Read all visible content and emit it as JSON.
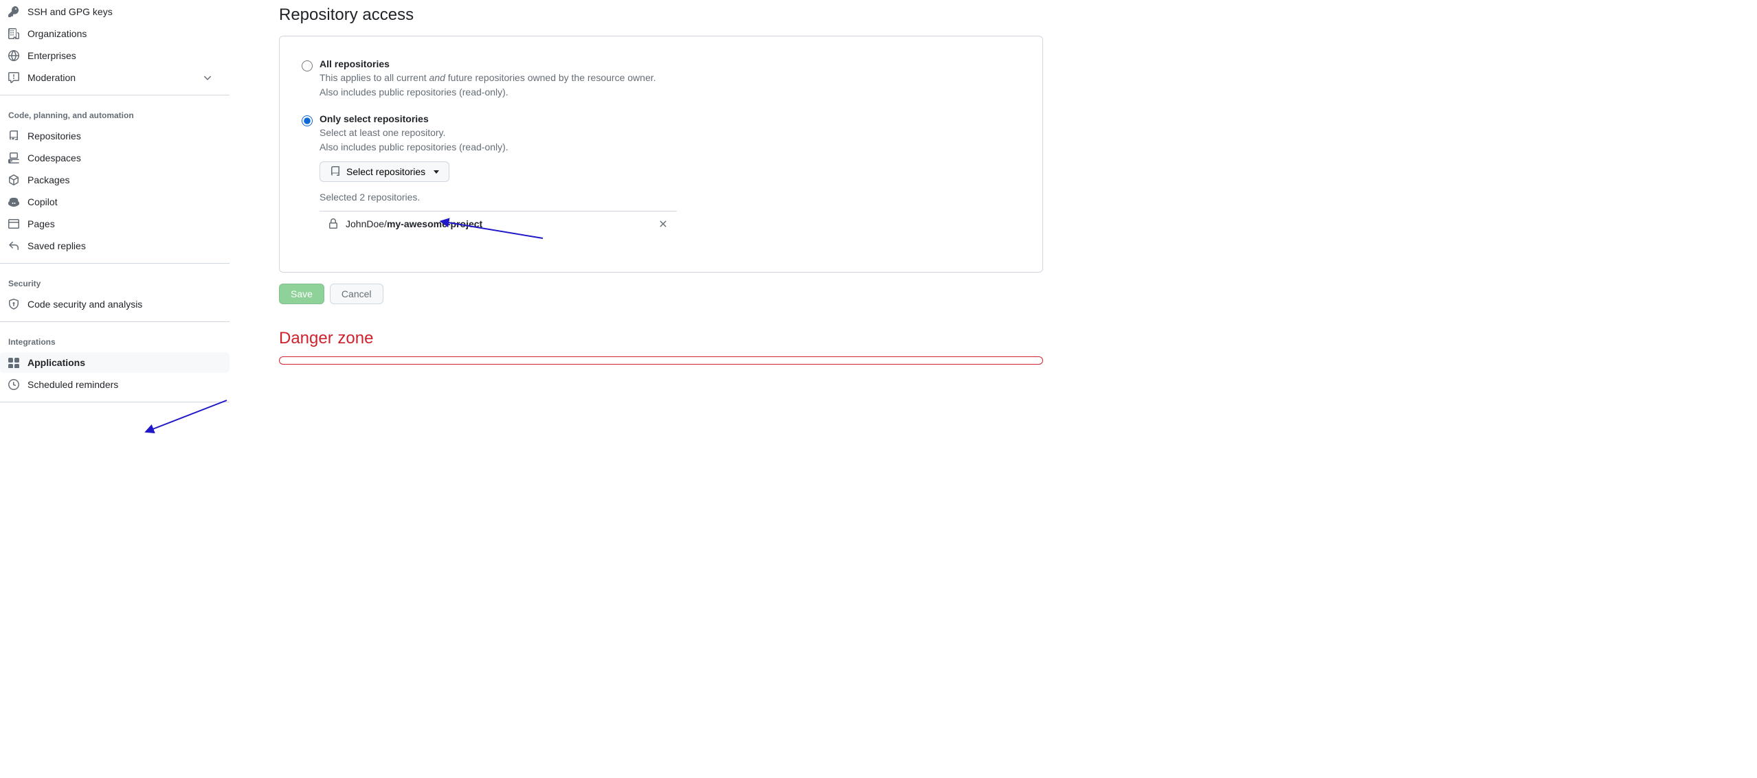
{
  "sidebar": {
    "items_top": [
      {
        "label": "SSH and GPG keys"
      },
      {
        "label": "Organizations"
      },
      {
        "label": "Enterprises"
      },
      {
        "label": "Moderation"
      }
    ],
    "section_code": "Code, planning, and automation",
    "items_code": [
      {
        "label": "Repositories"
      },
      {
        "label": "Codespaces"
      },
      {
        "label": "Packages"
      },
      {
        "label": "Copilot"
      },
      {
        "label": "Pages"
      },
      {
        "label": "Saved replies"
      }
    ],
    "section_security": "Security",
    "items_security": [
      {
        "label": "Code security and analysis"
      }
    ],
    "section_integrations": "Integrations",
    "items_integrations": [
      {
        "label": "Applications"
      },
      {
        "label": "Scheduled reminders"
      }
    ]
  },
  "main": {
    "title": "Repository access",
    "all_repos": {
      "label": "All repositories",
      "desc_prefix": "This applies to all current ",
      "desc_italic": "and",
      "desc_suffix": " future repositories owned by the resource owner.",
      "desc_line2": "Also includes public repositories (read-only)."
    },
    "only_select": {
      "label": "Only select repositories",
      "desc_line1": "Select at least one repository.",
      "desc_line2": "Also includes public repositories (read-only).",
      "button": "Select repositories",
      "selected_text": "Selected 2 repositories."
    },
    "selected_repo": {
      "owner": "JohnDoe/",
      "name": "my-awesome-project"
    },
    "save_label": "Save",
    "cancel_label": "Cancel",
    "danger_title": "Danger zone"
  }
}
